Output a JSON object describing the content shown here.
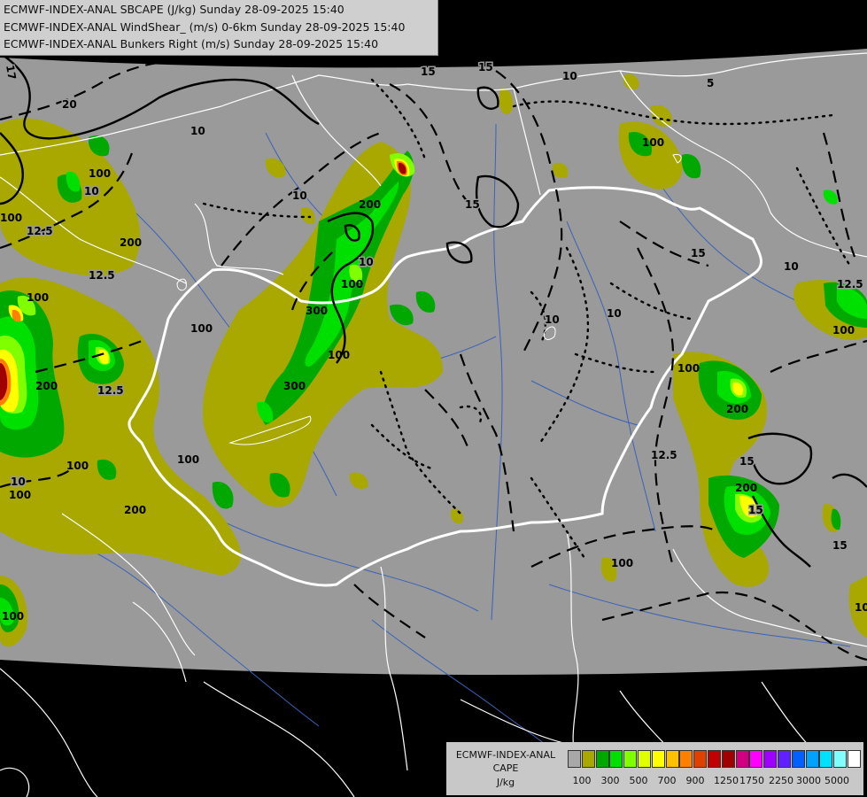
{
  "header": {
    "lines": [
      "ECMWF-INDEX-ANAL SBCAPE (J/kg) Sunday 28-09-2025 15:40",
      "ECMWF-INDEX-ANAL WindShear_ (m/s) 0-6km Sunday 28-09-2025 15:40",
      "ECMWF-INDEX-ANAL Bunkers Right (m/s) Sunday 28-09-2025 15:40"
    ]
  },
  "contour_labels": {
    "wind_shear": [
      "17",
      "20",
      "10",
      "10",
      "12.5",
      "15",
      "15",
      "10",
      "5",
      "10",
      "10",
      "10",
      "15",
      "12.5",
      "10",
      "15",
      "12.5",
      "12.5",
      "10",
      "15",
      "12.5",
      "15",
      "10",
      "15"
    ],
    "cape": [
      "100",
      "100",
      "200",
      "200",
      "300",
      "100",
      "100",
      "100",
      "100",
      "100",
      "200",
      "100",
      "200",
      "200",
      "100",
      "200",
      "100",
      "100",
      "300",
      "100",
      "100",
      "100",
      "100"
    ]
  },
  "legend": {
    "title_lines": [
      "ECMWF-INDEX-ANAL",
      "CAPE",
      "J/kg"
    ],
    "colors": [
      "#a8a8a8",
      "#a8a800",
      "#00a800",
      "#00e000",
      "#7fff00",
      "#e0ff00",
      "#ffff00",
      "#ffc000",
      "#ff8000",
      "#e04000",
      "#c00000",
      "#a00000",
      "#d00080",
      "#ff00ff",
      "#a000ff",
      "#6020ff",
      "#0060ff",
      "#00a0ff",
      "#00e0ff",
      "#80ffff",
      "#ffffff"
    ],
    "ticks": [
      "100",
      "300",
      "500",
      "700",
      "900",
      "1250",
      "1750",
      "2250",
      "3000",
      "5000"
    ]
  }
}
